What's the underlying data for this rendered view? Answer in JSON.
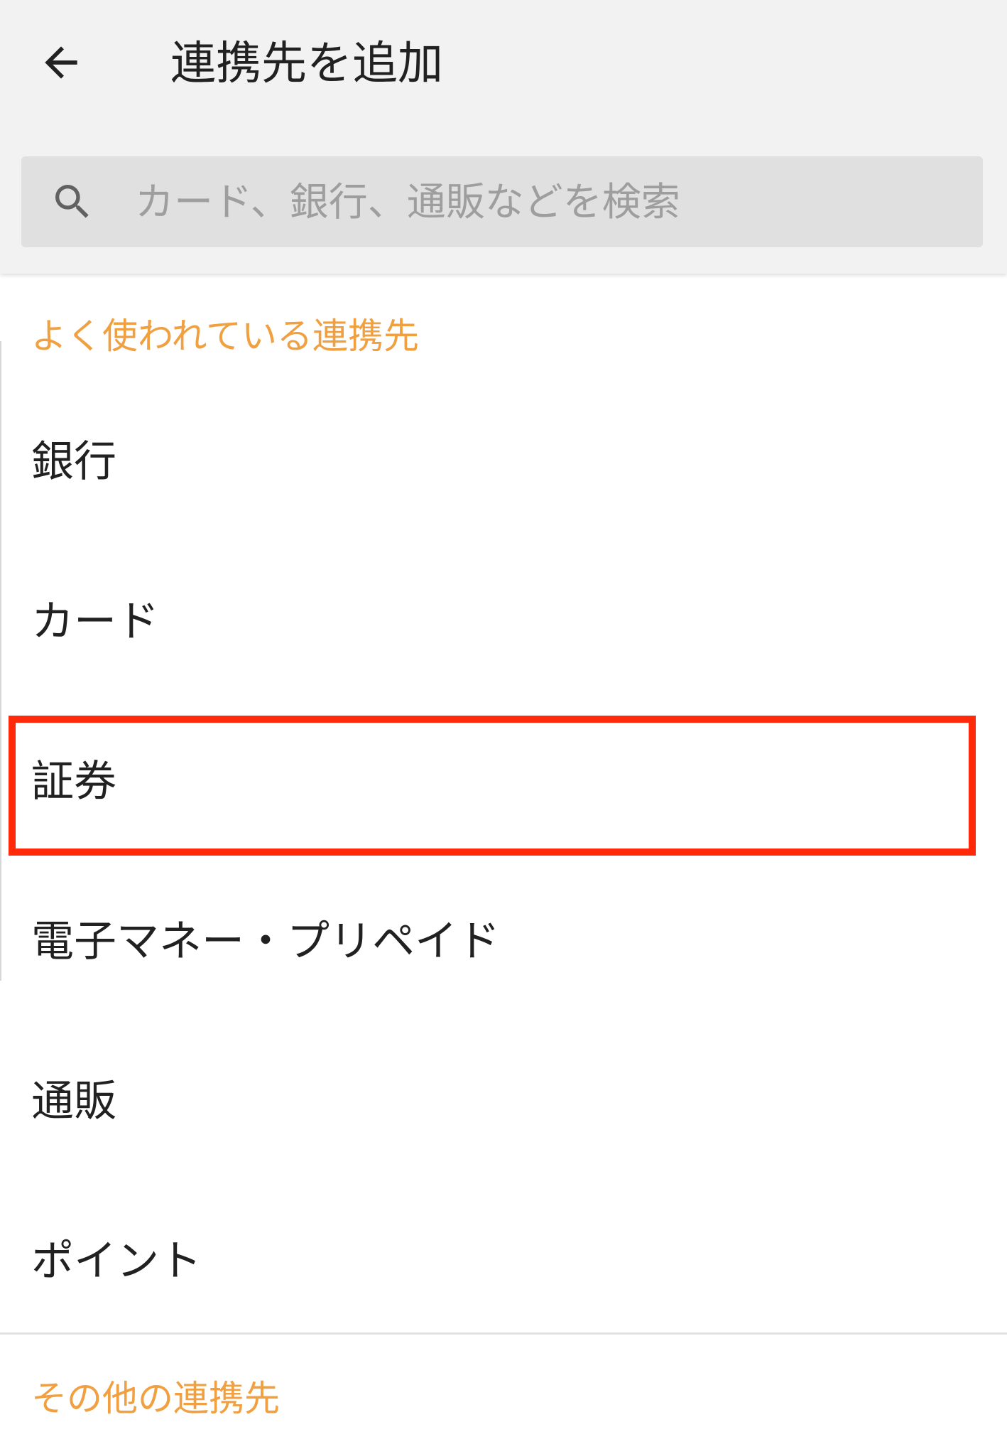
{
  "header": {
    "title": "連携先を追加",
    "back_icon": "arrow-left-icon"
  },
  "search": {
    "placeholder": "カード、銀行、通販などを検索",
    "value": "",
    "icon": "search-icon"
  },
  "sections": {
    "popular": {
      "title": "よく使われている連携先",
      "items": [
        {
          "label": "銀行"
        },
        {
          "label": "カード"
        },
        {
          "label": "証券"
        },
        {
          "label": "電子マネー・プリペイド"
        },
        {
          "label": "通販"
        },
        {
          "label": "ポイント"
        }
      ]
    },
    "other": {
      "title": "その他の連携先"
    }
  },
  "colors": {
    "accent": "#f0a040",
    "highlight": "#ff2a0a",
    "header_bg": "#f2f2f2",
    "search_bg": "#e0e0e0",
    "text": "#212121"
  }
}
